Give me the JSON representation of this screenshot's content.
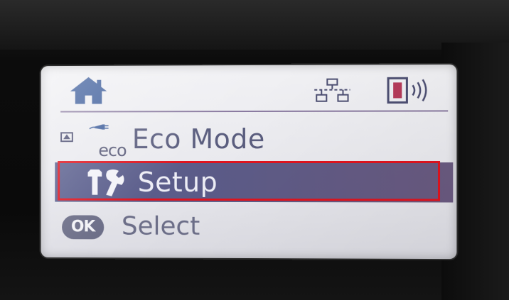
{
  "menu": {
    "items": [
      {
        "label": "Eco Mode",
        "sub_label": "eco",
        "icon": "eco-plug-icon",
        "selected": false
      },
      {
        "label": "Setup",
        "icon": "wrench-screwdriver-icon",
        "selected": true
      }
    ]
  },
  "hint": {
    "button": "OK",
    "label": "Select"
  },
  "status": {
    "icons": [
      "home-icon",
      "wired-network-icon",
      "wifi-signal-icon"
    ]
  },
  "colors": {
    "selection_border": "#e0141e",
    "selected_row": "#5a5f8e",
    "text": "#5a5d7e"
  }
}
